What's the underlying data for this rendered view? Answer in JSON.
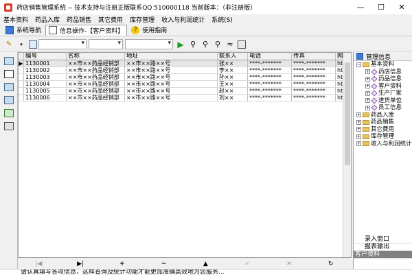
{
  "window": {
    "title": "药店销售管理系统 -- 技术支持与注册正版联系QQ 510000118    当前版本：（非注册版）",
    "minimize": "—",
    "maximize": "☐",
    "close": "✕"
  },
  "menu": [
    "基本资料",
    "药品入库",
    "药品销售",
    "其它费用",
    "库存管理",
    "收入与利润统计",
    "系统(S)"
  ],
  "tabs": [
    {
      "label": "系统导航"
    },
    {
      "label": "信息操作-【客户资料】"
    },
    {
      "label": "使用指南"
    }
  ],
  "toolbar": {
    "combo1": "",
    "combo2": "",
    "combo3": ""
  },
  "grid": {
    "columns": [
      "编号",
      "名称",
      "地址",
      "联系人",
      "电话",
      "传真",
      "网址"
    ],
    "rows": [
      {
        "id": "1130001",
        "name": "××市××药品经销部",
        "addr": "××市××路××号",
        "contact": "张××",
        "phone": "****-*******",
        "fax": "****-*******",
        "web": "htt"
      },
      {
        "id": "1130002",
        "name": "××市××药品经销部",
        "addr": "××市××路××号",
        "contact": "李××",
        "phone": "****-*******",
        "fax": "****-*******",
        "web": "htt"
      },
      {
        "id": "1130003",
        "name": "××市××药品经销部",
        "addr": "××市××路××号",
        "contact": "孙××",
        "phone": "****-*******",
        "fax": "****-*******",
        "web": "htt"
      },
      {
        "id": "1130004",
        "name": "××市××药品经销部",
        "addr": "××市××路××号",
        "contact": "王××",
        "phone": "****-*******",
        "fax": "****-*******",
        "web": "htt"
      },
      {
        "id": "1130005",
        "name": "××市××药品经销部",
        "addr": "××市××路××号",
        "contact": "赵××",
        "phone": "****-*******",
        "fax": "****-*******",
        "web": "htt"
      },
      {
        "id": "1130006",
        "name": "××市××药品经销部",
        "addr": "××市××路××号",
        "contact": "刘××",
        "phone": "****-*******",
        "fax": "****-*******",
        "web": "htt"
      }
    ]
  },
  "navbar": {
    "first": "|◀",
    "last": "▶|",
    "add": "+",
    "del": "−",
    "up": "▲",
    "check": "✓",
    "cancel": "✕",
    "refresh": "↻"
  },
  "right_panel": {
    "title": "管理信息",
    "tree": [
      {
        "label": "基本资料",
        "level": 0,
        "open": true
      },
      {
        "label": "药店信息",
        "level": 1
      },
      {
        "label": "药品信息",
        "level": 1
      },
      {
        "label": "客户资料",
        "level": 1
      },
      {
        "label": "生产厂家",
        "level": 1
      },
      {
        "label": "进货单位",
        "level": 1
      },
      {
        "label": "员工信息",
        "level": 1
      },
      {
        "label": "药品入库",
        "level": 0
      },
      {
        "label": "药品销售",
        "level": 0
      },
      {
        "label": "其它费用",
        "level": 0
      },
      {
        "label": "库存管理",
        "level": 0
      },
      {
        "label": "收入与利润统计",
        "level": 0
      }
    ],
    "buttons": [
      "录入窗口",
      "报表输出",
      "客户资料"
    ]
  },
  "status": "请认真填写各项信息，这样查询及统计功能才能更加准确高效地为您服务..."
}
